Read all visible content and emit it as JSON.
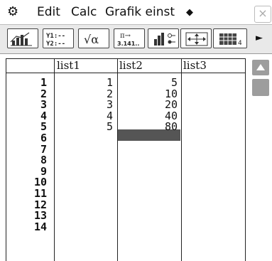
{
  "menubar": {
    "icon": "gear-icon",
    "items": [
      "Edit",
      "Calc",
      "Grafik einst"
    ],
    "more_icon": "diamond-icon",
    "close_label": "×"
  },
  "toolbar": {
    "buttons": [
      {
        "icon": "bar-chart-icon"
      },
      {
        "icon": "equation-list-icon",
        "line1": "Y1:--",
        "line2": "Y2:--"
      },
      {
        "icon": "sqrt-alpha-icon",
        "label": "√α"
      },
      {
        "icon": "pi-decimal-icon",
        "line1": "π→",
        "line2": "3.141.."
      },
      {
        "icon": "stat-graph-icon"
      },
      {
        "icon": "zoom-icon"
      },
      {
        "icon": "table-icon"
      }
    ],
    "next_arrow": "►"
  },
  "table": {
    "columns": [
      "list1",
      "list2",
      "list3"
    ],
    "row_numbers": [
      "1",
      "2",
      "3",
      "4",
      "5",
      "6",
      "7",
      "8",
      "9",
      "10",
      "11",
      "12",
      "13",
      "14"
    ],
    "list1": [
      "1",
      "2",
      "3",
      "4",
      "5"
    ],
    "list2": [
      "5",
      "10",
      "20",
      "40",
      "80"
    ],
    "list3": []
  },
  "scrollbar": {
    "up_icon": "scroll-up-arrow-icon"
  }
}
